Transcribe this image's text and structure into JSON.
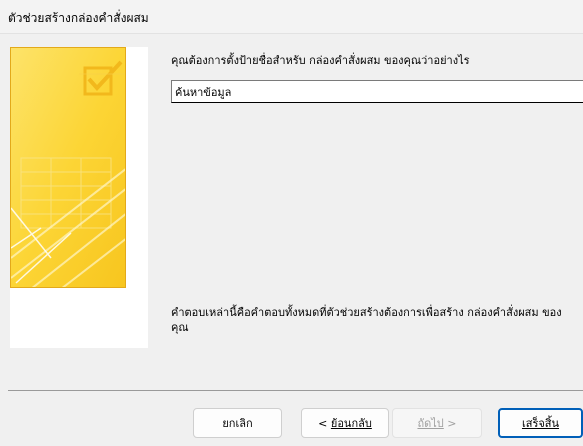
{
  "window": {
    "title": "ตัวช่วยสร้างกล่องคำสั่งผสม"
  },
  "main": {
    "prompt": "คุณต้องการตั้งป้ายชื่อสำหรับ กล่องคำสั่งผสม ของคุณว่าอย่างไร",
    "label_value": "ค้นหาข้อมูล",
    "description": "คำตอบเหล่านี้คือคำตอบทั้งหมดที่ตัวช่วยสร้างต้องการเพื่อสร้าง กล่องคำสั่งผสม ของคุณ"
  },
  "footer": {
    "cancel_label": "ยกเลิก",
    "back_prefix": "< ",
    "back_label": "ย้อนกลับ",
    "next_label": "ถัดไป",
    "next_suffix": " >",
    "finish_label": "เสร็จสิ้น"
  },
  "colors": {
    "art_gold": "#fcd535",
    "art_border": "#e3a91a",
    "default_button_border": "#005fb8"
  },
  "icons": {
    "wizard_art": "checkbox-illustration"
  }
}
